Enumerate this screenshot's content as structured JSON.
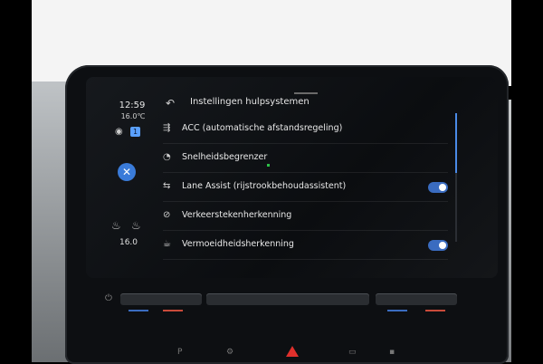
{
  "status": {
    "time": "12:59",
    "temp_top": "16.0℃",
    "badge": "1",
    "temp_bottom": "16.0"
  },
  "header": {
    "title": "Instellingen hulpsystemen"
  },
  "list": {
    "items": [
      {
        "label": "ACC (automatische afstandsregeling)",
        "icon": "acc-icon",
        "toggle": false
      },
      {
        "label": "Snelheidsbegrenzer",
        "icon": "speed-limiter-icon",
        "toggle": false
      },
      {
        "label": "Lane Assist (rijstrookbehoudassistent)",
        "icon": "lane-assist-icon",
        "toggle": true
      },
      {
        "label": "Verkeerstekenherkenning",
        "icon": "traffic-sign-icon",
        "toggle": false
      },
      {
        "label": "Vermoeidheidsherkenning",
        "icon": "fatigue-icon",
        "toggle": true
      }
    ]
  },
  "colors": {
    "accent": "#3a6cc0",
    "close_button": "#3a7bd9",
    "hazard": "#e0302c"
  },
  "icons": {
    "back": "back-arrow-icon",
    "close": "close-icon",
    "wireless": "wireless-charging-icon",
    "seat_heat": "seat-heating-icon",
    "chevron": "chevron-right-icon",
    "power": "power-icon",
    "hazard": "hazard-icon"
  }
}
